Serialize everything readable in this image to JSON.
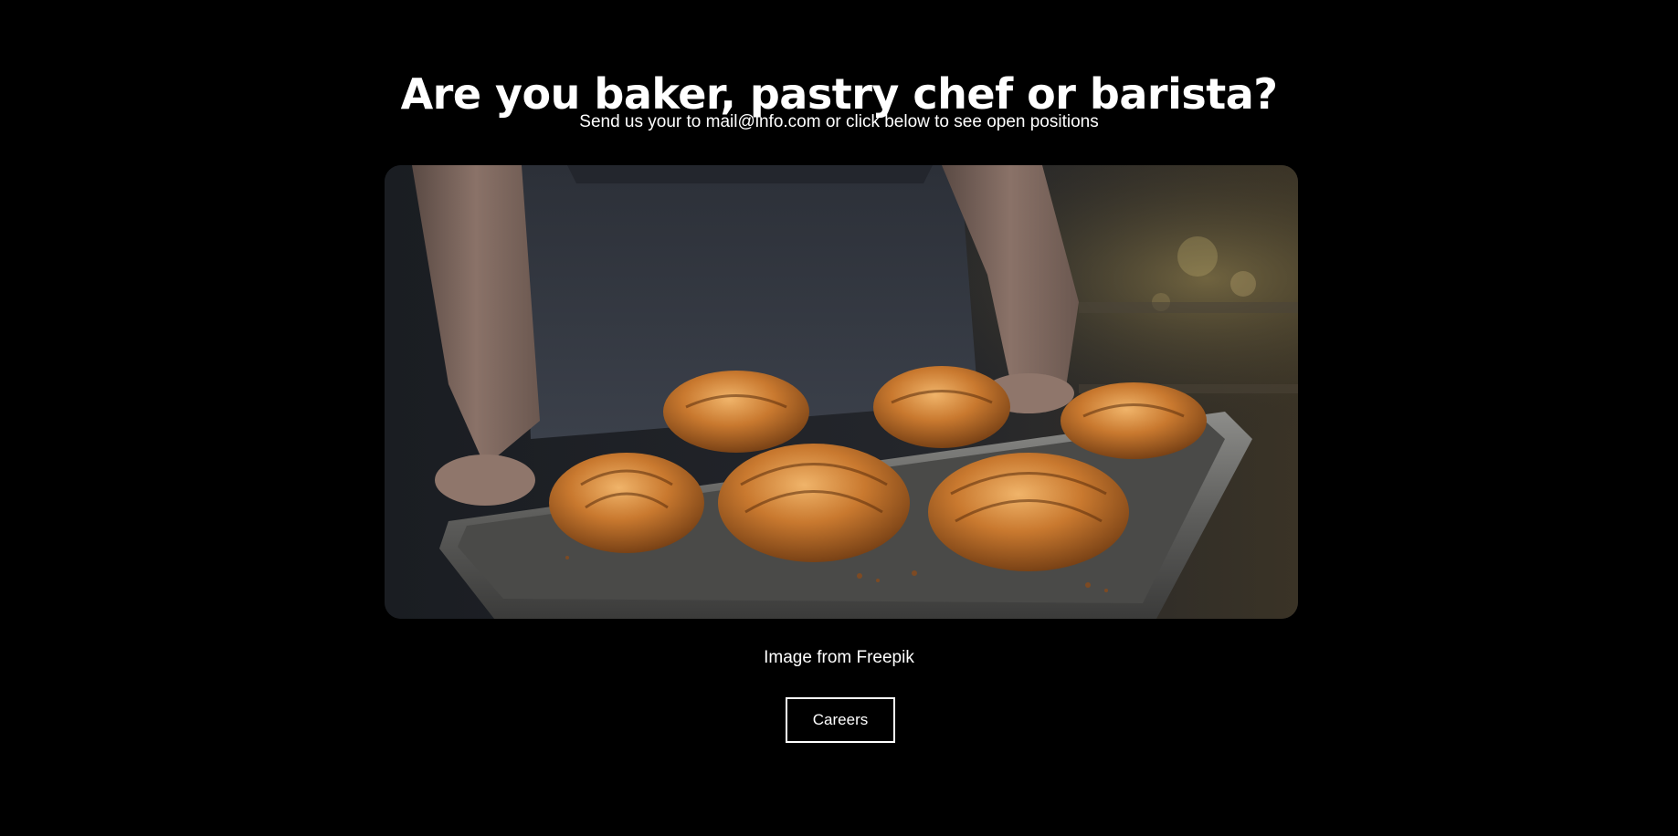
{
  "hero": {
    "title": "Are you baker, pastry chef or barista?",
    "subtitle": "Send us your to mail@info.com or click below to see open positions"
  },
  "image": {
    "subject": "croissants-on-baking-tray",
    "credit": "Image from Freepik"
  },
  "cta": {
    "label": "Careers"
  },
  "colors": {
    "background": "#000000",
    "text": "#ffffff",
    "button_border": "#ffffff"
  }
}
